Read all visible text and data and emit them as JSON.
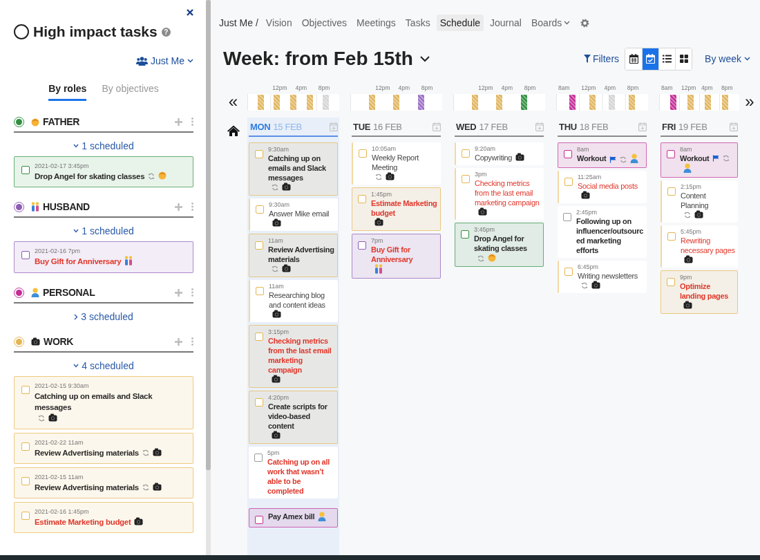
{
  "sidebar": {
    "title": "High impact tasks",
    "help": "?",
    "owner": "Just Me",
    "tabs": [
      {
        "label": "By roles",
        "selected": true
      },
      {
        "label": "By objectives",
        "selected": false
      }
    ],
    "roles": [
      {
        "kind": "father",
        "name": "FATHER",
        "color": "#2f8f3f",
        "scheduled": "1 scheduled",
        "expanded": true,
        "tasks": [
          {
            "when": "2021-02-17 3:45pm",
            "title": "Drop Angel for skating classes",
            "checked": false,
            "overdue": false,
            "recurring": true
          }
        ]
      },
      {
        "kind": "husband",
        "name": "HUSBAND",
        "color": "#8e5bb5",
        "scheduled": "1 scheduled",
        "expanded": true,
        "tasks": [
          {
            "when": "2021-02-16 7pm",
            "title": "Buy Gift for Anniversary",
            "checked": false,
            "overdue": true,
            "recurring": false
          }
        ]
      },
      {
        "kind": "personal",
        "name": "PERSONAL",
        "color": "#c42d96",
        "scheduled": "3 scheduled",
        "expanded": false
      },
      {
        "kind": "work",
        "name": "WORK",
        "color": "#e6b550",
        "scheduled": "4 scheduled",
        "expanded": true,
        "tasks": [
          {
            "when": "2021-02-15 9:30am",
            "title": "Catching up on emails and Slack messages",
            "checked": false,
            "overdue": false,
            "recurring": true
          },
          {
            "when": "2021-02-22 11am",
            "title": "Review Advertising materials",
            "checked": false,
            "overdue": false,
            "recurring": true
          },
          {
            "when": "2021-02-15 11am",
            "title": "Review Advertising materials",
            "checked": false,
            "overdue": false,
            "recurring": true
          },
          {
            "when": "2021-02-16 1:45pm",
            "title": "Estimate Marketing budget",
            "checked": false,
            "overdue": true,
            "recurring": false
          }
        ]
      }
    ]
  },
  "nav": {
    "breadcrumb": "Just Me /",
    "items": [
      {
        "label": "Vision",
        "selected": false,
        "dropdown": false
      },
      {
        "label": "Objectives",
        "selected": false,
        "dropdown": false
      },
      {
        "label": "Meetings",
        "selected": false,
        "dropdown": false
      },
      {
        "label": "Tasks",
        "selected": false,
        "dropdown": false
      },
      {
        "label": "Schedule",
        "selected": true,
        "dropdown": false
      },
      {
        "label": "Journal",
        "selected": false,
        "dropdown": false
      },
      {
        "label": "Boards",
        "selected": false,
        "dropdown": true
      }
    ]
  },
  "header": {
    "title": "Week: from Feb 15th",
    "filters": "Filters",
    "period": "By week",
    "views": [
      {
        "kind": "calendar",
        "selected": false
      },
      {
        "kind": "calendar-check",
        "selected": true
      },
      {
        "kind": "list",
        "selected": false
      },
      {
        "kind": "grid",
        "selected": false
      }
    ]
  },
  "calendar": {
    "prev": "«",
    "next": "»",
    "days": [
      {
        "weekday": "MON",
        "date": "15 FEB",
        "today": true,
        "ticks": [
          "12pm",
          "4pm",
          "8pm"
        ],
        "blocks": [
          {
            "color": "#e0b55f"
          },
          {
            "color": "#e0b55f"
          },
          {
            "color": "#e0b55f"
          },
          {
            "color": "#e0b55f"
          },
          {
            "color": "#d4d4d4"
          }
        ],
        "tasks": [
          {
            "time": "9:30am",
            "title": "Catching up on emails and Slack messages",
            "kind": "work",
            "checked": false,
            "highlighted": true,
            "bold": true,
            "overdue": false,
            "recurring": true,
            "flag": false
          },
          {
            "time": "9:30am",
            "title": "Answer Mike email",
            "kind": "work",
            "checked": false,
            "highlighted": false,
            "bold": false,
            "overdue": false,
            "recurring": false,
            "flag": false
          },
          {
            "time": "11am",
            "title": "Review Advertising materials",
            "kind": "work",
            "checked": false,
            "highlighted": true,
            "bold": true,
            "overdue": false,
            "recurring": true,
            "flag": false
          },
          {
            "time": "11am",
            "title": "Researching blog and content ideas",
            "kind": "work",
            "checked": false,
            "highlighted": false,
            "bold": false,
            "overdue": false,
            "recurring": false,
            "flag": false
          },
          {
            "time": "3:15pm",
            "title": "Checking metrics from the last email marketing campaign",
            "kind": "work",
            "checked": false,
            "highlighted": true,
            "bold": true,
            "overdue": true,
            "recurring": false,
            "flag": false
          },
          {
            "time": "4:20pm",
            "title": "Create scripts for video-based content",
            "kind": "work",
            "checked": false,
            "highlighted": true,
            "bold": true,
            "overdue": false,
            "recurring": false,
            "flag": false
          },
          {
            "time": "5pm",
            "title": "Catching up on all work that wasn’t able to be completed",
            "checked": false,
            "highlighted": false,
            "bold": true,
            "overdue": true,
            "recurring": false,
            "flag": false
          }
        ],
        "later_tasks": [
          {
            "title": "Pay Amex bill",
            "kind": "personal",
            "checked": false,
            "highlighted": true,
            "bold": true,
            "overdue": false,
            "recurring": false,
            "flag": false
          }
        ]
      },
      {
        "weekday": "TUE",
        "date": "16 FEB",
        "today": false,
        "ticks": [
          "12pm",
          "4pm",
          "8pm"
        ],
        "blocks": [
          {
            "color": "#e0b55f"
          },
          {
            "color": "#e0b55f"
          },
          {
            "color": "#9b6fc4"
          }
        ],
        "tasks": [
          {
            "time": "10:05am",
            "title": "Weekly Report Meeting",
            "kind": "work",
            "checked": false,
            "highlighted": false,
            "bold": false,
            "overdue": false,
            "recurring": true,
            "flag": false
          },
          {
            "time": "1:45pm",
            "title": "Estimate Marketing budget",
            "kind": "work",
            "checked": false,
            "highlighted": true,
            "bold": true,
            "overdue": true,
            "recurring": false,
            "flag": false
          },
          {
            "time": "7pm",
            "title": "Buy Gift for Anniversary",
            "kind": "husband",
            "checked": false,
            "highlighted": true,
            "bold": true,
            "overdue": true,
            "recurring": false,
            "flag": false
          }
        ]
      },
      {
        "weekday": "WED",
        "date": "17 FEB",
        "today": false,
        "ticks": [
          "12pm",
          "4pm",
          "8pm"
        ],
        "blocks": [
          {
            "color": "#e0b55f"
          },
          {
            "color": "#e0b55f"
          },
          {
            "color": "#2f8f3f"
          }
        ],
        "tasks": [
          {
            "time": "9:20am",
            "title": "Copywriting",
            "kind": "work",
            "checked": false,
            "highlighted": false,
            "bold": false,
            "overdue": false,
            "recurring": false,
            "flag": false
          },
          {
            "time": "3pm",
            "title": "Checking metrics from the last email marketing campaign",
            "kind": "work",
            "checked": false,
            "highlighted": false,
            "bold": false,
            "overdue": true,
            "recurring": false,
            "flag": false
          },
          {
            "time": "3:45pm",
            "title": "Drop Angel for skating classes",
            "kind": "father",
            "checked": false,
            "highlighted": true,
            "bold": true,
            "overdue": false,
            "recurring": true,
            "flag": false
          }
        ]
      },
      {
        "weekday": "THU",
        "date": "18 FEB",
        "today": false,
        "ticks": [
          "8am",
          "12pm",
          "4pm",
          "8pm"
        ],
        "blocks": [
          {
            "color": "#c42d96"
          },
          {
            "color": "#e0b55f"
          },
          {
            "color": "#d4d4d4"
          },
          {
            "color": "#e0b55f"
          }
        ],
        "tasks": [
          {
            "time": "8am",
            "title": "Workout",
            "kind": "personal",
            "checked": false,
            "highlighted": true,
            "bold": true,
            "overdue": false,
            "recurring": true,
            "flag": true
          },
          {
            "time": "11:25am",
            "title": "Social media posts",
            "kind": "work",
            "checked": false,
            "highlighted": false,
            "bold": false,
            "overdue": true,
            "recurring": false,
            "flag": false
          },
          {
            "time": "2:45pm",
            "title": "Following up on influencer/outsourced marketing efforts",
            "checked": false,
            "highlighted": false,
            "bold": true,
            "overdue": false,
            "recurring": false,
            "flag": false
          },
          {
            "time": "6:45pm",
            "title": "Writing newsletters",
            "kind": "work",
            "checked": false,
            "highlighted": false,
            "bold": false,
            "overdue": false,
            "recurring": true,
            "flag": false
          }
        ]
      },
      {
        "weekday": "FRI",
        "date": "19 FEB",
        "today": false,
        "ticks": [
          "8am",
          "12pm",
          "4pm",
          "8pm"
        ],
        "blocks": [
          {
            "color": "#c42d96"
          },
          {
            "color": "#e0b55f"
          },
          {
            "color": "#e0b55f"
          },
          {
            "color": "#e0b55f"
          }
        ],
        "tasks": [
          {
            "time": "8am",
            "title": "Workout",
            "kind": "personal",
            "checked": false,
            "highlighted": true,
            "bold": true,
            "overdue": false,
            "recurring": true,
            "flag": true
          },
          {
            "time": "2:15pm",
            "title": "Content Planning",
            "kind": "work",
            "checked": false,
            "highlighted": false,
            "bold": false,
            "overdue": false,
            "recurring": true,
            "flag": false
          },
          {
            "time": "5:45pm",
            "title": "Rewriting necessary pages",
            "kind": "work",
            "checked": false,
            "highlighted": false,
            "bold": false,
            "overdue": true,
            "recurring": false,
            "flag": false
          },
          {
            "time": "9pm",
            "title": "Optimize landing pages",
            "kind": "work",
            "checked": false,
            "highlighted": true,
            "bold": true,
            "overdue": true,
            "recurring": false,
            "flag": false
          }
        ]
      }
    ]
  }
}
